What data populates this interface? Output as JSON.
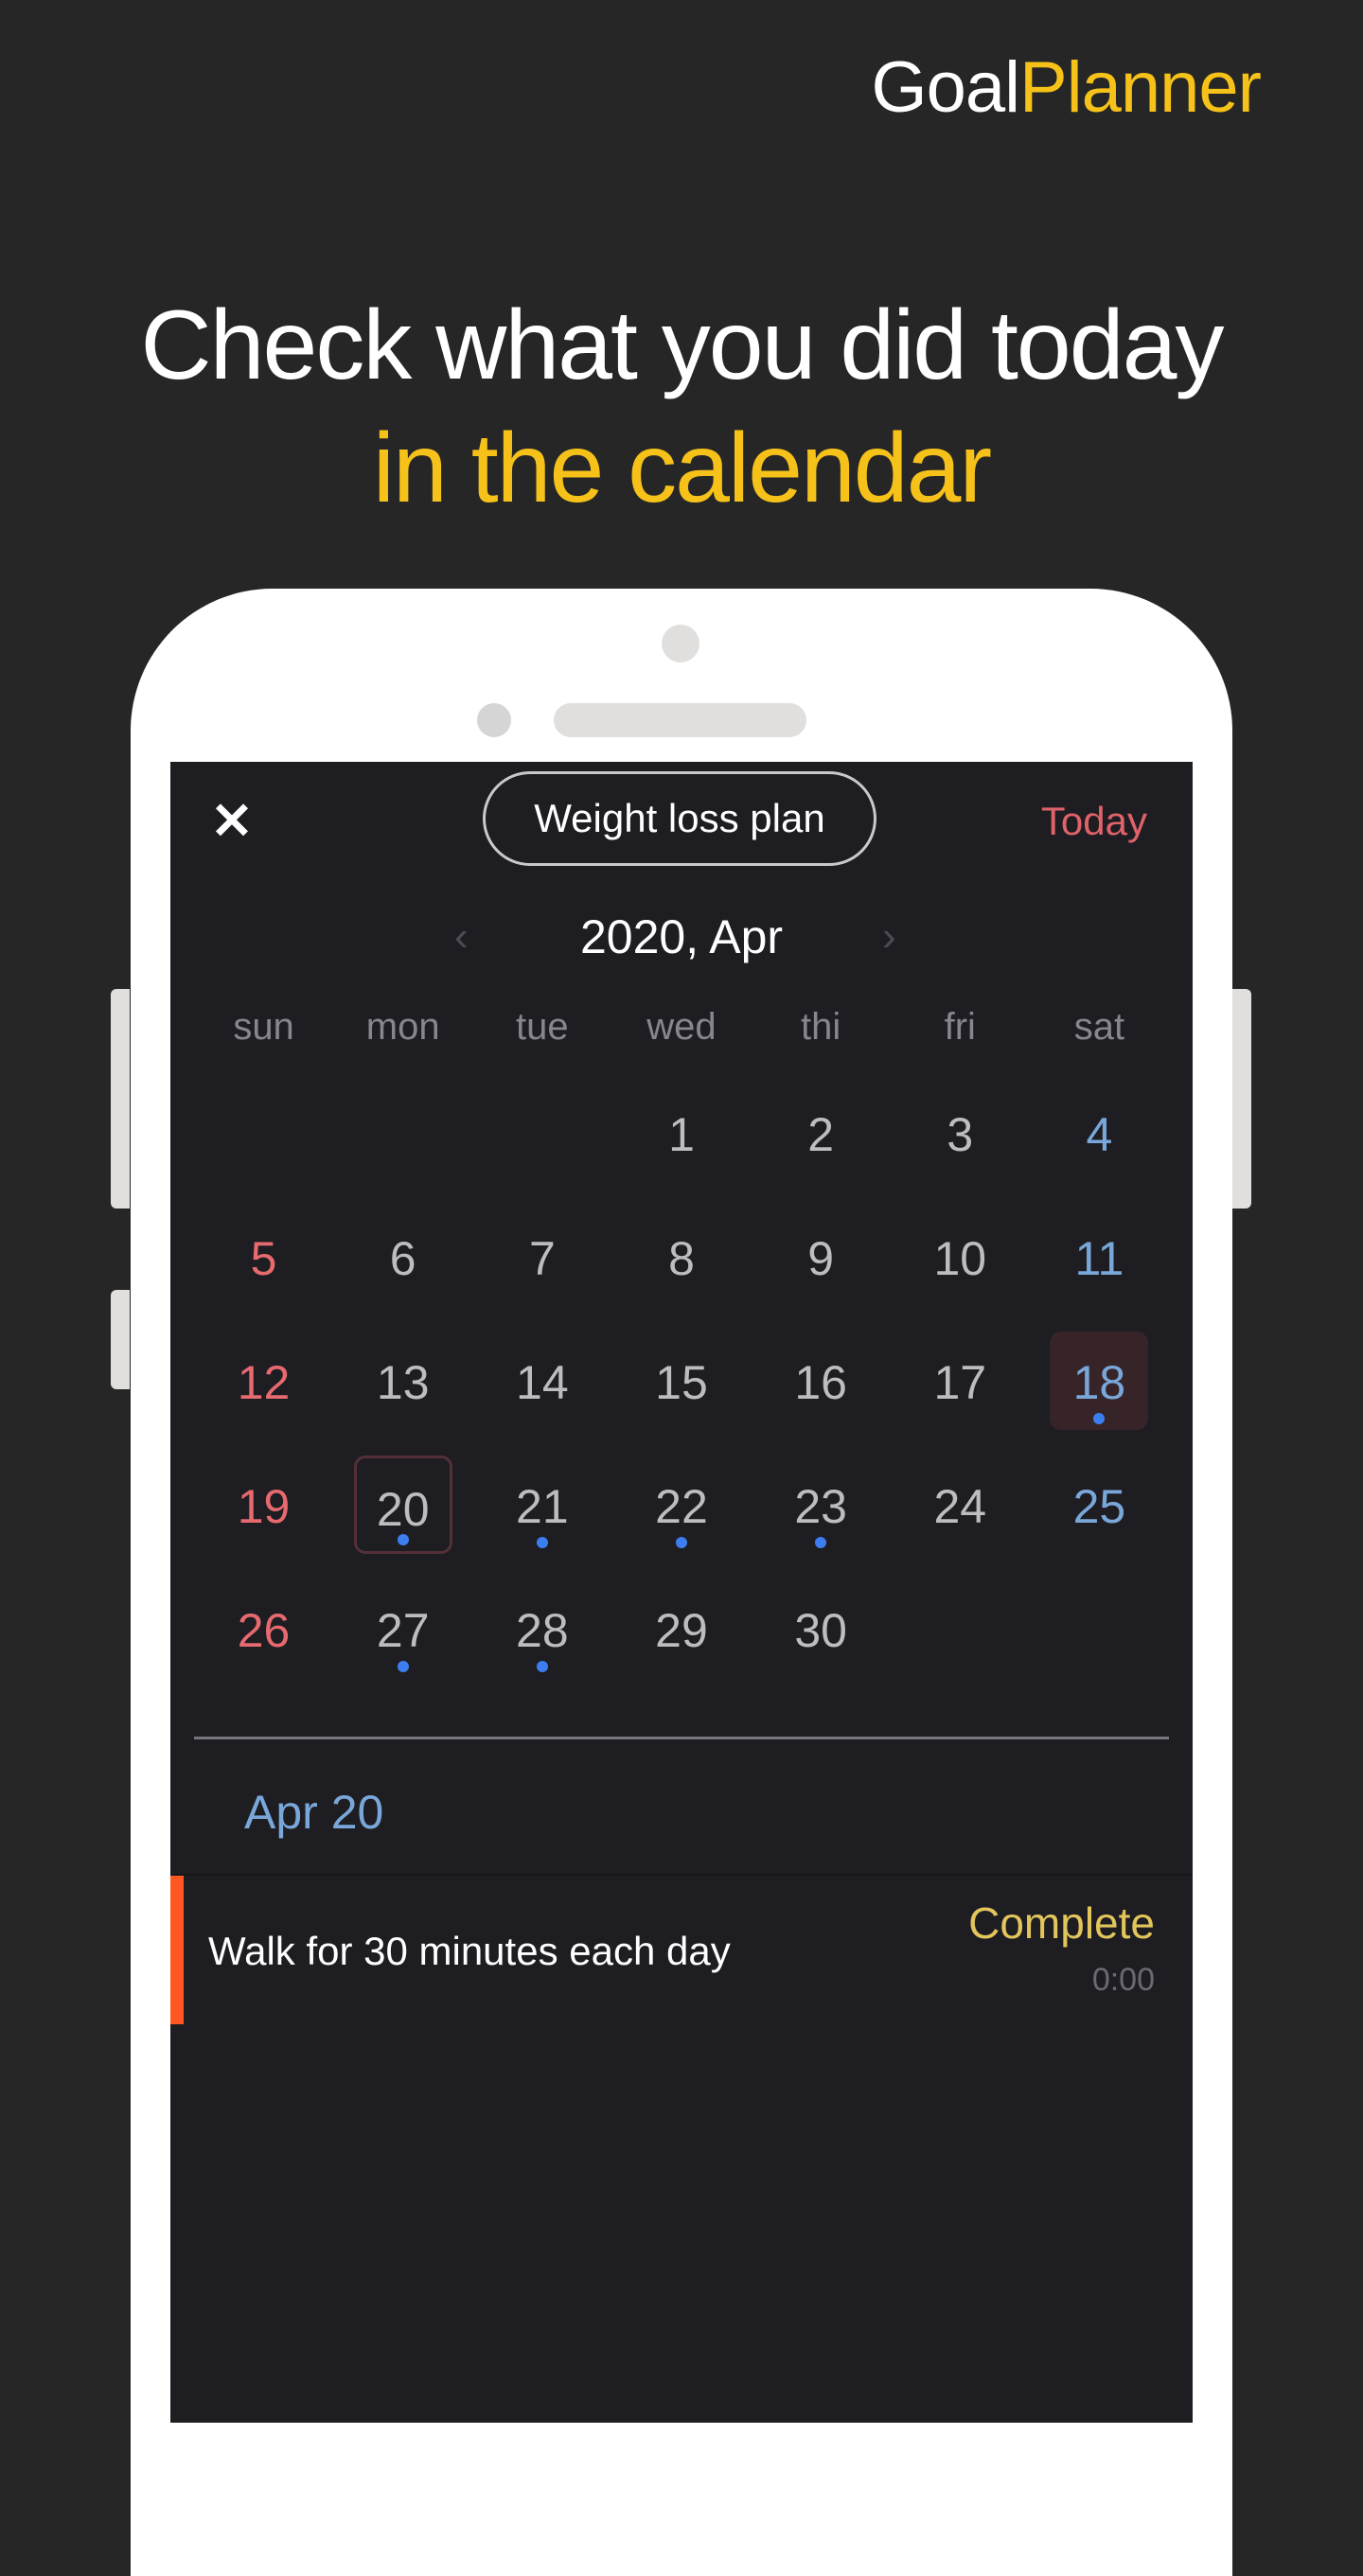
{
  "brand": {
    "part1": "Goal",
    "part2": "Planner"
  },
  "headline": {
    "line1": "Check what you did today",
    "line2": "in the calendar"
  },
  "colors": {
    "accent_yellow": "#f6c21a",
    "sunday": "#e66a6f",
    "saturday": "#7aa7da",
    "event_dot": "#3c7ef0",
    "task_accent": "#ff5722",
    "today_link": "#e0626a",
    "complete": "#e2c55b"
  },
  "app": {
    "close_icon": "close-icon",
    "plan_name": "Weight loss plan",
    "today_label": "Today",
    "month_label": "2020, Apr",
    "prev_icon": "‹",
    "next_icon": "›",
    "weekdays": [
      "sun",
      "mon",
      "tue",
      "wed",
      "thi",
      "fri",
      "sat"
    ],
    "weeks": [
      [
        {
          "d": ""
        },
        {
          "d": ""
        },
        {
          "d": ""
        },
        {
          "d": "1"
        },
        {
          "d": "2"
        },
        {
          "d": "3"
        },
        {
          "d": "4"
        }
      ],
      [
        {
          "d": "5"
        },
        {
          "d": "6"
        },
        {
          "d": "7"
        },
        {
          "d": "8"
        },
        {
          "d": "9"
        },
        {
          "d": "10"
        },
        {
          "d": "11"
        }
      ],
      [
        {
          "d": "12"
        },
        {
          "d": "13"
        },
        {
          "d": "14"
        },
        {
          "d": "15"
        },
        {
          "d": "16"
        },
        {
          "d": "17"
        },
        {
          "d": "18",
          "dot": true,
          "today": true
        }
      ],
      [
        {
          "d": "19"
        },
        {
          "d": "20",
          "dot": true,
          "selected": true
        },
        {
          "d": "21",
          "dot": true
        },
        {
          "d": "22",
          "dot": true
        },
        {
          "d": "23",
          "dot": true
        },
        {
          "d": "24"
        },
        {
          "d": "25"
        }
      ],
      [
        {
          "d": "26"
        },
        {
          "d": "27",
          "dot": true
        },
        {
          "d": "28",
          "dot": true
        },
        {
          "d": "29"
        },
        {
          "d": "30"
        },
        {
          "d": ""
        },
        {
          "d": ""
        }
      ]
    ],
    "selected_date_label": "Apr 20",
    "tasks": [
      {
        "title": "Walk for 30 minutes each day",
        "status": "Complete",
        "time": "0:00"
      }
    ]
  }
}
